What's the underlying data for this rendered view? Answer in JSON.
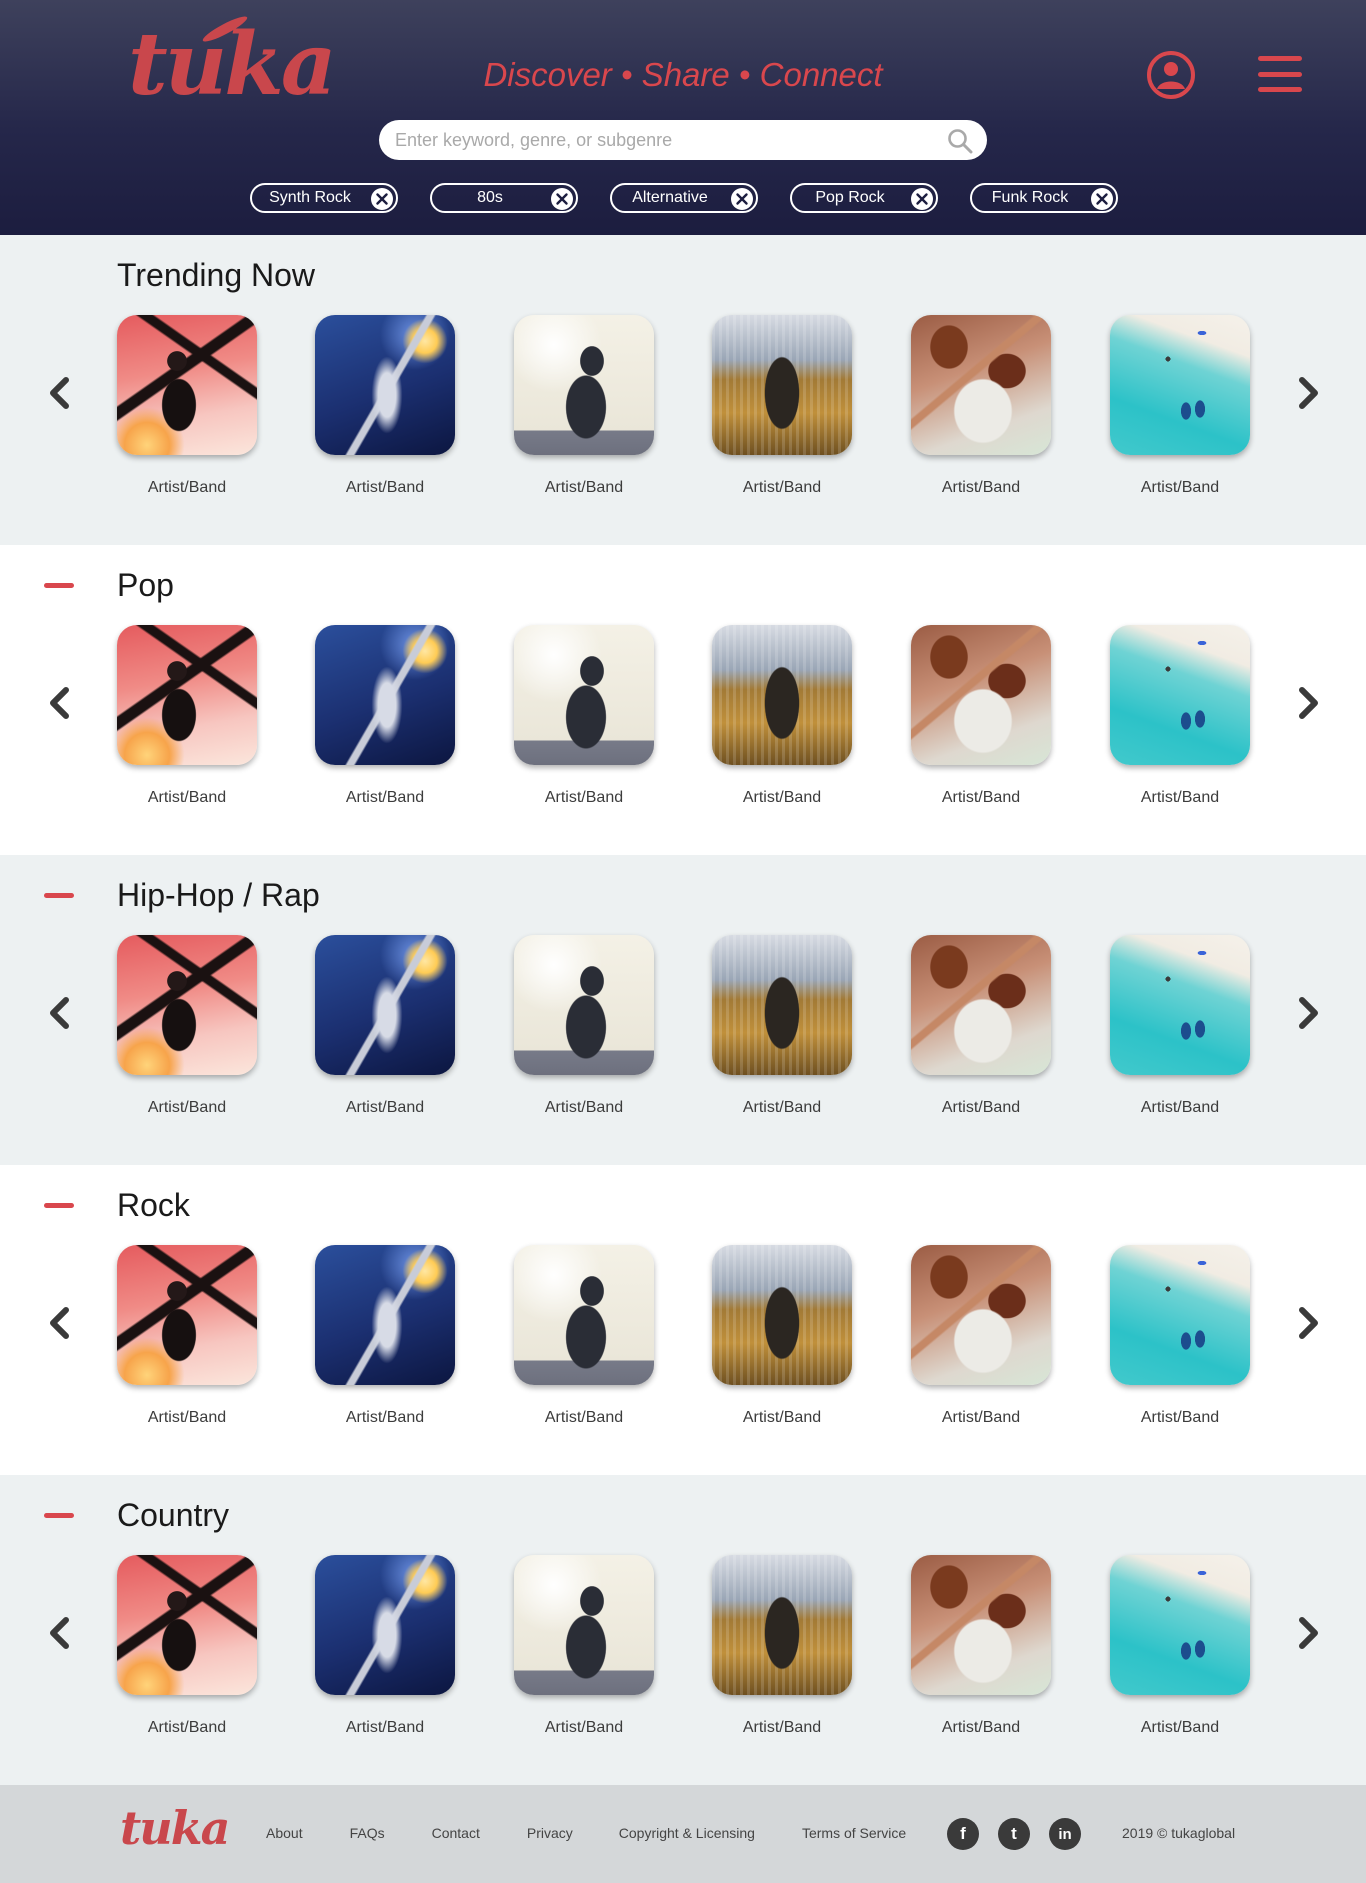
{
  "brand": {
    "name": "tuka",
    "color": "#d9474d"
  },
  "header": {
    "tagline": "Discover • Share • Connect",
    "search": {
      "placeholder": "Enter keyword, genre, or subgenre",
      "value": ""
    },
    "filter_chips": [
      {
        "label": "Synth Rock"
      },
      {
        "label": "80s"
      },
      {
        "label": "Alternative"
      },
      {
        "label": "Pop Rock"
      },
      {
        "label": "Funk Rock"
      }
    ],
    "icons": {
      "account": "user-circle-icon",
      "menu": "hamburger-menu-icon",
      "search": "search-icon"
    }
  },
  "sections": [
    {
      "title": "Trending Now",
      "collapsible": false,
      "cards": [
        {
          "label": "Artist/Band"
        },
        {
          "label": "Artist/Band"
        },
        {
          "label": "Artist/Band"
        },
        {
          "label": "Artist/Band"
        },
        {
          "label": "Artist/Band"
        },
        {
          "label": "Artist/Band"
        }
      ]
    },
    {
      "title": "Pop",
      "collapsible": true,
      "cards": [
        {
          "label": "Artist/Band"
        },
        {
          "label": "Artist/Band"
        },
        {
          "label": "Artist/Band"
        },
        {
          "label": "Artist/Band"
        },
        {
          "label": "Artist/Band"
        },
        {
          "label": "Artist/Band"
        }
      ]
    },
    {
      "title": "Hip-Hop / Rap",
      "collapsible": true,
      "cards": [
        {
          "label": "Artist/Band"
        },
        {
          "label": "Artist/Band"
        },
        {
          "label": "Artist/Band"
        },
        {
          "label": "Artist/Band"
        },
        {
          "label": "Artist/Band"
        },
        {
          "label": "Artist/Band"
        }
      ]
    },
    {
      "title": "Rock",
      "collapsible": true,
      "cards": [
        {
          "label": "Artist/Band"
        },
        {
          "label": "Artist/Band"
        },
        {
          "label": "Artist/Band"
        },
        {
          "label": "Artist/Band"
        },
        {
          "label": "Artist/Band"
        },
        {
          "label": "Artist/Band"
        }
      ]
    },
    {
      "title": "Country",
      "collapsible": true,
      "cards": [
        {
          "label": "Artist/Band"
        },
        {
          "label": "Artist/Band"
        },
        {
          "label": "Artist/Band"
        },
        {
          "label": "Artist/Band"
        },
        {
          "label": "Artist/Band"
        },
        {
          "label": "Artist/Band"
        }
      ]
    }
  ],
  "footer": {
    "links": [
      {
        "label": "About"
      },
      {
        "label": "FAQs"
      },
      {
        "label": "Contact"
      },
      {
        "label": "Privacy"
      },
      {
        "label": "Copyright & Licensing"
      },
      {
        "label": "Terms of Service"
      }
    ],
    "social": [
      {
        "icon": "facebook-icon",
        "glyph": "f"
      },
      {
        "icon": "twitter-icon",
        "glyph": "t"
      },
      {
        "icon": "linkedin-icon",
        "glyph": "in"
      }
    ],
    "copyright": "2019 © tukaglobal"
  }
}
